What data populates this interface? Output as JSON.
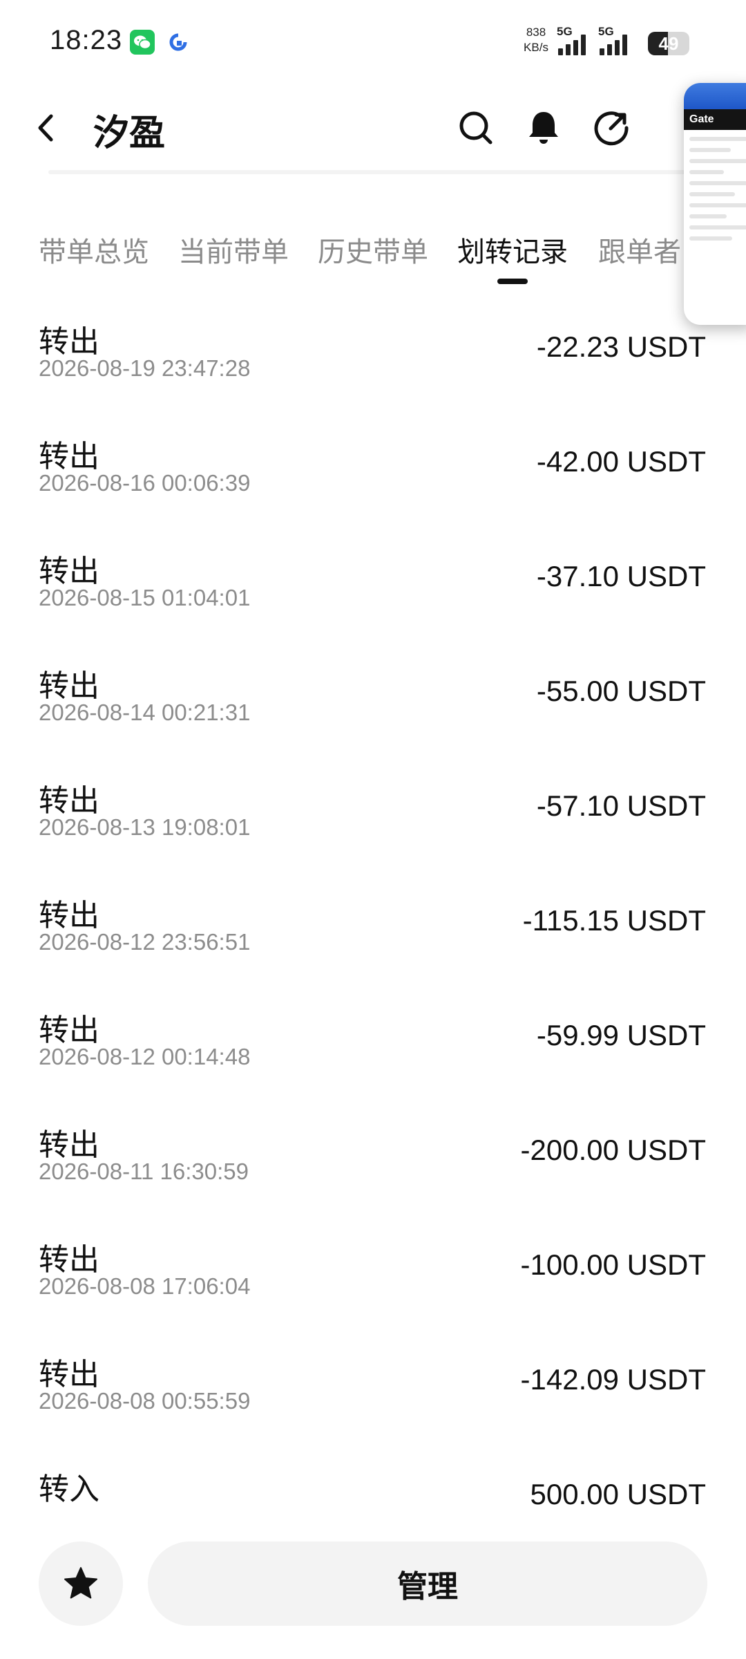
{
  "status_bar": {
    "time": "18:23",
    "speed_value": "838",
    "speed_unit": "KB/s",
    "network_1": "5G",
    "network_2": "5G",
    "battery": "49",
    "battery_level_percent": 49,
    "icons": [
      "wechat-icon",
      "app-icon",
      "signal-icon",
      "battery-icon"
    ]
  },
  "header": {
    "title": "汐盈",
    "icons": [
      "back-icon",
      "search-icon",
      "bell-icon",
      "share-icon"
    ]
  },
  "floating_preview": {
    "brand": "Gate"
  },
  "tabs": [
    {
      "label": "带单总览",
      "active": false
    },
    {
      "label": "当前带单",
      "active": false
    },
    {
      "label": "历史带单",
      "active": false
    },
    {
      "label": "划转记录",
      "active": true
    },
    {
      "label": "跟单者",
      "active": false
    }
  ],
  "records": [
    {
      "type": "转出",
      "time": "2026-08-19 23:47:28",
      "amount": "-22.23 USDT"
    },
    {
      "type": "转出",
      "time": "2026-08-16 00:06:39",
      "amount": "-42.00 USDT"
    },
    {
      "type": "转出",
      "time": "2026-08-15 01:04:01",
      "amount": "-37.10 USDT"
    },
    {
      "type": "转出",
      "time": "2026-08-14 00:21:31",
      "amount": "-55.00 USDT"
    },
    {
      "type": "转出",
      "time": "2026-08-13 19:08:01",
      "amount": "-57.10 USDT"
    },
    {
      "type": "转出",
      "time": "2026-08-12 23:56:51",
      "amount": "-115.15 USDT"
    },
    {
      "type": "转出",
      "time": "2026-08-12 00:14:48",
      "amount": "-59.99 USDT"
    },
    {
      "type": "转出",
      "time": "2026-08-11 16:30:59",
      "amount": "-200.00 USDT"
    },
    {
      "type": "转出",
      "time": "2026-08-08 17:06:04",
      "amount": "-100.00 USDT"
    },
    {
      "type": "转出",
      "time": "2026-08-08 00:55:59",
      "amount": "-142.09 USDT"
    },
    {
      "type": "转入",
      "time": "",
      "amount": "500.00 USDT"
    }
  ],
  "bottom_bar": {
    "manage_label": "管理",
    "icons": [
      "star-icon"
    ]
  },
  "colors": {
    "text_primary": "#111111",
    "text_secondary": "#8c8c8c",
    "button_bg": "#f3f3f3",
    "wechat_green": "#21c55d"
  }
}
